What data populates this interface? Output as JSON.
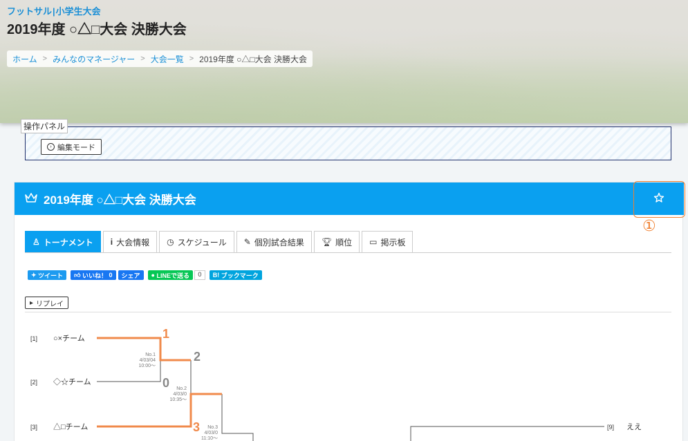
{
  "header": {
    "sport": "フットサル",
    "category": "小学生大会",
    "title": "2019年度 ○△□大会 決勝大会"
  },
  "breadcrumb": {
    "home": "ホーム",
    "manager": "みんなのマネージャー",
    "list": "大会一覧",
    "current": "2019年度 ○△□大会 決勝大会"
  },
  "panel": {
    "label": "操作パネル",
    "edit_label": "編集モード"
  },
  "card": {
    "title": "2019年度 ○△□大会 決勝大会",
    "icons": {
      "crown": "crown-icon",
      "favorite": "star-icon"
    }
  },
  "annotation": {
    "number": "①"
  },
  "tabs": [
    {
      "label": "トーナメント",
      "icon": "tournament-icon",
      "active": true
    },
    {
      "label": "大会情報",
      "icon": "info-icon"
    },
    {
      "label": "スケジュール",
      "icon": "clock-icon"
    },
    {
      "label": "個別試合結果",
      "icon": "pencil-icon"
    },
    {
      "label": "順位",
      "icon": "trophy-icon"
    },
    {
      "label": "掲示板",
      "icon": "chat-icon"
    }
  ],
  "share": {
    "tweet": "ツイート",
    "like": "いいね！",
    "like_count": "0",
    "share": "シェア",
    "line": "LINEで送る",
    "line_count": "0",
    "hatena": "ブックマーク"
  },
  "replay_label": "リプレイ",
  "bracket": {
    "teams": [
      {
        "seed": "[1]",
        "name": "○×チーム"
      },
      {
        "seed": "[2]",
        "name": "◇☆チーム"
      },
      {
        "seed": "[3]",
        "name": "△□チーム"
      },
      {
        "seed": "[9]",
        "name": "ええ"
      }
    ],
    "matches": [
      {
        "no": "No.1",
        "date": "4/03/04",
        "time": "10:00～"
      },
      {
        "no": "No.2",
        "date": "4/03/0",
        "time": "10:35～"
      },
      {
        "no": "No.3",
        "date": "4/03/0",
        "time": "11:10～"
      }
    ],
    "scores": [
      "1",
      "0",
      "2",
      "3"
    ],
    "colors": {
      "winner": "#f08a4b",
      "loser": "#888888",
      "line": "#555555"
    }
  }
}
